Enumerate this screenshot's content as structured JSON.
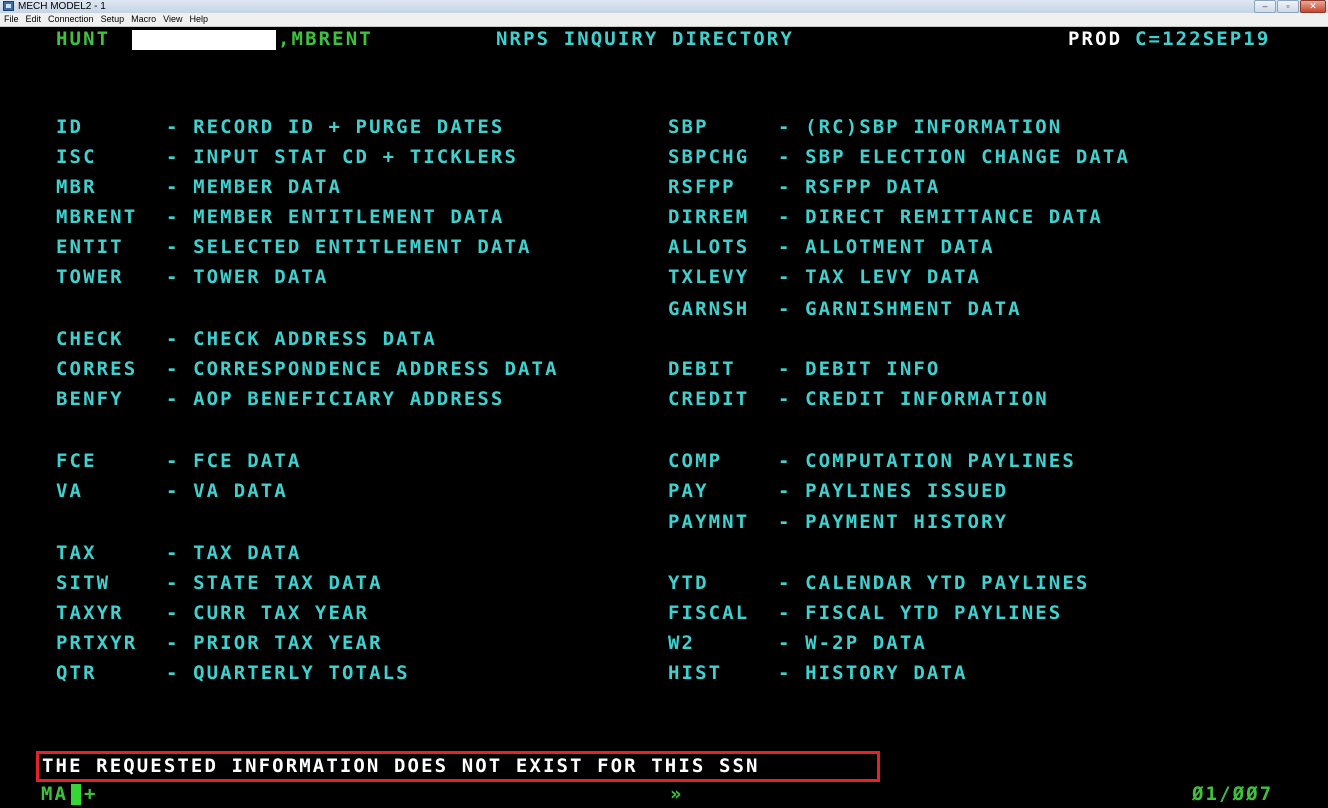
{
  "window": {
    "title": "MECH MODEL2 - 1",
    "min_glyph": "–",
    "max_glyph": "▫",
    "close_glyph": "✕"
  },
  "menu": [
    "File",
    "Edit",
    "Connection",
    "Setup",
    "Macro",
    "View",
    "Help"
  ],
  "header": {
    "user": "HUNT",
    "screen_code": ",MBRENT",
    "title": "NRPS INQUIRY DIRECTORY",
    "env": "PROD",
    "cycle": "C=122SEP19"
  },
  "left_groups": [
    [
      {
        "code": "ID",
        "desc": "- RECORD ID + PURGE DATES"
      },
      {
        "code": "ISC",
        "desc": "- INPUT STAT CD + TICKLERS"
      },
      {
        "code": "MBR",
        "desc": "- MEMBER DATA"
      },
      {
        "code": "MBRENT",
        "desc": "- MEMBER ENTITLEMENT DATA"
      },
      {
        "code": "ENTIT",
        "desc": "- SELECTED ENTITLEMENT DATA"
      },
      {
        "code": "TOWER",
        "desc": "- TOWER DATA"
      }
    ],
    [
      {
        "code": "CHECK",
        "desc": "- CHECK ADDRESS DATA"
      },
      {
        "code": "CORRES",
        "desc": "- CORRESPONDENCE ADDRESS DATA"
      },
      {
        "code": "BENFY",
        "desc": "- AOP BENEFICIARY ADDRESS"
      }
    ],
    [
      {
        "code": "FCE",
        "desc": "- FCE DATA"
      },
      {
        "code": "VA",
        "desc": "- VA DATA"
      }
    ],
    [
      {
        "code": "TAX",
        "desc": "- TAX DATA"
      },
      {
        "code": "SITW",
        "desc": "- STATE TAX DATA"
      },
      {
        "code": "TAXYR",
        "desc": "- CURR TAX YEAR"
      },
      {
        "code": "PRTXYR",
        "desc": "- PRIOR TAX YEAR"
      },
      {
        "code": "QTR",
        "desc": "- QUARTERLY TOTALS"
      }
    ]
  ],
  "right_groups": [
    [
      {
        "code": "SBP",
        "desc": "- (RC)SBP INFORMATION"
      },
      {
        "code": "SBPCHG",
        "desc": "- SBP ELECTION CHANGE DATA"
      },
      {
        "code": "RSFPP",
        "desc": "- RSFPP DATA"
      },
      {
        "code": "DIRREM",
        "desc": "- DIRECT REMITTANCE DATA"
      },
      {
        "code": "ALLOTS",
        "desc": "- ALLOTMENT DATA"
      },
      {
        "code": "TXLEVY",
        "desc": "- TAX LEVY DATA"
      },
      {
        "code": "GARNSH",
        "desc": "- GARNISHMENT DATA"
      }
    ],
    [
      {
        "code": "DEBIT",
        "desc": "- DEBIT INFO"
      },
      {
        "code": "CREDIT",
        "desc": "- CREDIT INFORMATION"
      }
    ],
    [
      {
        "code": "COMP",
        "desc": "- COMPUTATION PAYLINES"
      },
      {
        "code": "PAY",
        "desc": "- PAYLINES ISSUED"
      },
      {
        "code": "PAYMNT",
        "desc": "- PAYMENT HISTORY"
      }
    ],
    [
      {
        "code": "YTD",
        "desc": "- CALENDAR YTD PAYLINES"
      },
      {
        "code": "FISCAL",
        "desc": "- FISCAL YTD PAYLINES"
      },
      {
        "code": "W2",
        "desc": "- W-2P DATA"
      },
      {
        "code": "HIST",
        "desc": "- HISTORY DATA"
      }
    ]
  ],
  "message": "THE REQUESTED INFORMATION DOES NOT EXIST FOR THIS SSN",
  "status": {
    "mode": "MA",
    "indicator": "+",
    "scroll_glyph": "»",
    "position": "Ø1/ØØ7"
  },
  "colors": {
    "text_cyan": "#3fd1cf",
    "text_green": "#3ec23e",
    "message_border": "#e52228"
  }
}
